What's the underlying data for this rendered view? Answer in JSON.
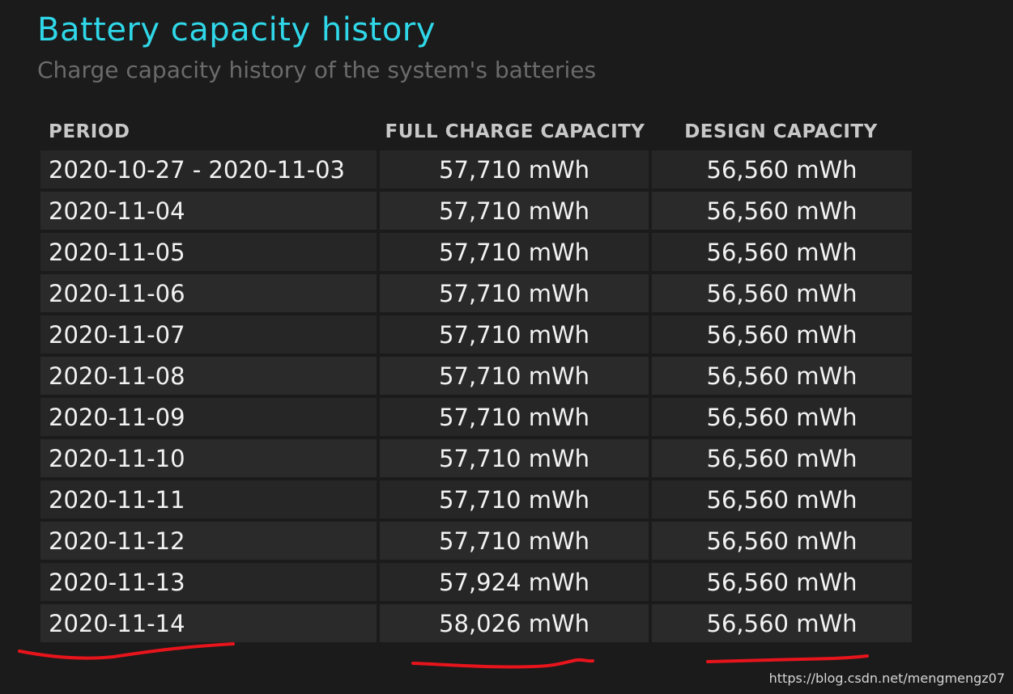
{
  "header": {
    "title": "Battery capacity history",
    "subtitle": "Charge capacity history of the system's batteries"
  },
  "table": {
    "columns": [
      "PERIOD",
      "FULL CHARGE CAPACITY",
      "DESIGN CAPACITY"
    ],
    "rows": [
      {
        "period": "2020-10-27 - 2020-11-03",
        "full": "57,710 mWh",
        "design": "56,560 mWh"
      },
      {
        "period": "2020-11-04",
        "full": "57,710 mWh",
        "design": "56,560 mWh"
      },
      {
        "period": "2020-11-05",
        "full": "57,710 mWh",
        "design": "56,560 mWh"
      },
      {
        "period": "2020-11-06",
        "full": "57,710 mWh",
        "design": "56,560 mWh"
      },
      {
        "period": "2020-11-07",
        "full": "57,710 mWh",
        "design": "56,560 mWh"
      },
      {
        "period": "2020-11-08",
        "full": "57,710 mWh",
        "design": "56,560 mWh"
      },
      {
        "period": "2020-11-09",
        "full": "57,710 mWh",
        "design": "56,560 mWh"
      },
      {
        "period": "2020-11-10",
        "full": "57,710 mWh",
        "design": "56,560 mWh"
      },
      {
        "period": "2020-11-11",
        "full": "57,710 mWh",
        "design": "56,560 mWh"
      },
      {
        "period": "2020-11-12",
        "full": "57,710 mWh",
        "design": "56,560 mWh"
      },
      {
        "period": "2020-11-13",
        "full": "57,924 mWh",
        "design": "56,560 mWh"
      },
      {
        "period": "2020-11-14",
        "full": "58,026 mWh",
        "design": "56,560 mWh"
      }
    ]
  },
  "annotation": {
    "underline_color": "#e8141c"
  },
  "watermark": "https://blog.csdn.net/mengmengz07"
}
